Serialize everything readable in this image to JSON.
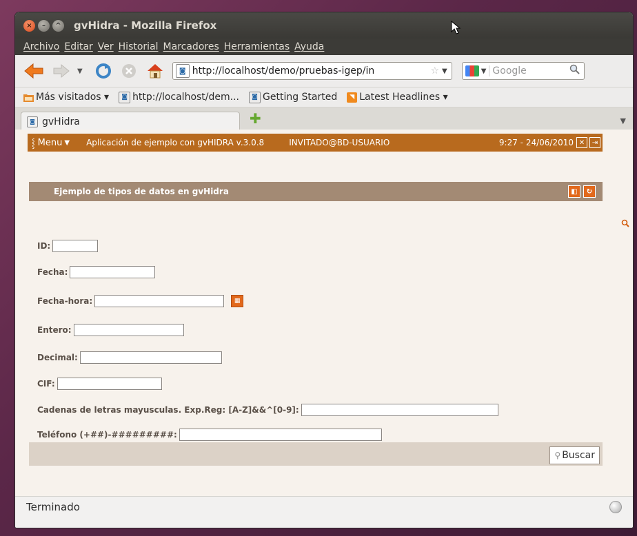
{
  "window": {
    "title": "gvHidra - Mozilla Firefox"
  },
  "menubar": [
    "Archivo",
    "Editar",
    "Ver",
    "Historial",
    "Marcadores",
    "Herramientas",
    "Ayuda"
  ],
  "navigation": {
    "url": "http://localhost/demo/pruebas-igep/in",
    "search_placeholder": "Google"
  },
  "bookmarks": [
    {
      "label": "Más visitados ▾",
      "icon": "folder-icon"
    },
    {
      "label": "http://localhost/dem...",
      "icon": "page-icon"
    },
    {
      "label": "Getting Started",
      "icon": "page-icon"
    },
    {
      "label": "Latest Headlines ▾",
      "icon": "rss-icon"
    }
  ],
  "tab": {
    "label": "gvHidra"
  },
  "app": {
    "menu_label": "Menu",
    "app_name": "Aplicación de ejemplo con gvHIDRA  v.3.0.8",
    "user": "INVITADO@BD-USUARIO",
    "datetime": "9:27 - 24/06/2010"
  },
  "panel": {
    "title": "Ejemplo de tipos de datos en gvHidra"
  },
  "form": {
    "id_label": "ID:",
    "fecha_label": "Fecha:",
    "fechahora_label": "Fecha-hora:",
    "entero_label": "Entero:",
    "decimal_label": "Decimal:",
    "cif_label": "CIF:",
    "cadenas_label": "Cadenas de letras mayusculas. Exp.Reg: [A-Z]&&^[0-9]:",
    "telefono_label": "Teléfono (+##)-#########:",
    "search_button": "Buscar"
  },
  "status": {
    "text": "Terminado"
  },
  "colors": {
    "accent": "#b86a1e",
    "panel_header": "#a38a74",
    "icon_orange": "#e2691c"
  }
}
